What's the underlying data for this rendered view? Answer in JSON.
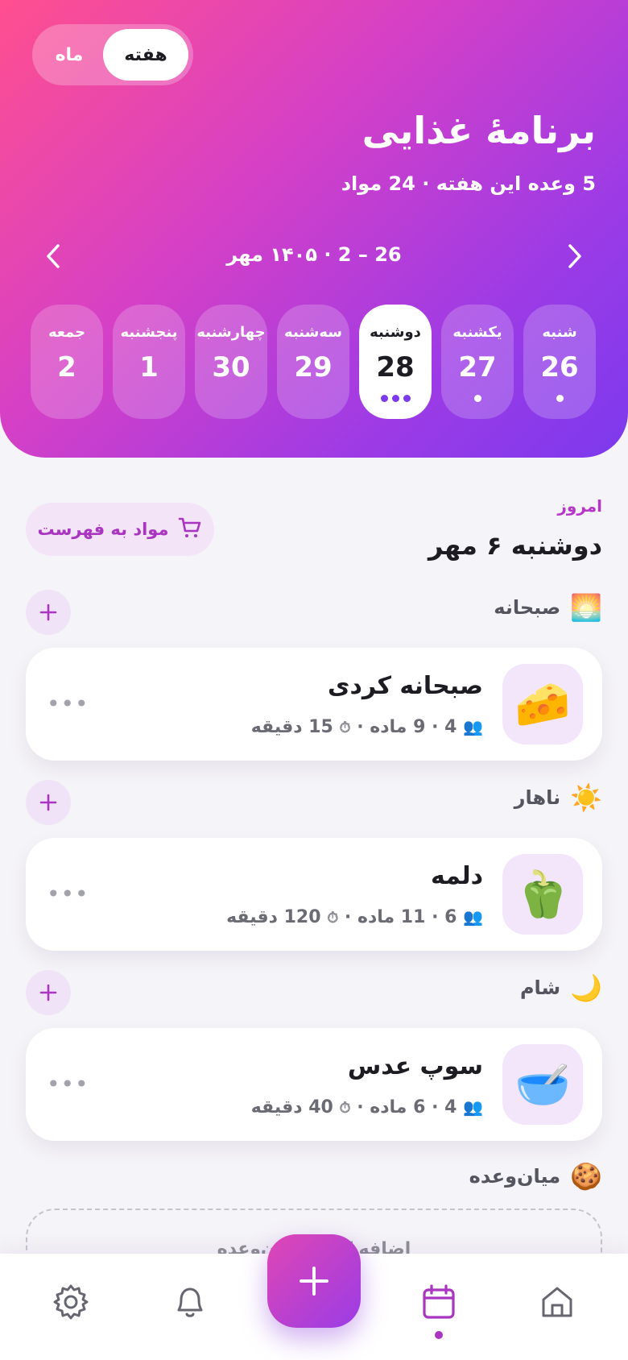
{
  "header": {
    "view_toggle": {
      "active": "هفته",
      "inactive": "ماه"
    },
    "title": "برنامۀ غذایی",
    "subtitle": "5 وعده این هفته · 24 مواد",
    "range": "26 – 2 · ۱۴۰۵ مهر",
    "days": [
      {
        "name": "شنبه",
        "num": "26",
        "dots": 1,
        "active": false
      },
      {
        "name": "یکشنبه",
        "num": "27",
        "dots": 1,
        "active": false
      },
      {
        "name": "دوشنبه",
        "num": "28",
        "dots": 3,
        "active": true
      },
      {
        "name": "سه‌شنبه",
        "num": "29",
        "dots": 0,
        "active": false
      },
      {
        "name": "چهارشنبه",
        "num": "30",
        "dots": 0,
        "active": false
      },
      {
        "name": "پنجشنبه",
        "num": "1",
        "dots": 0,
        "active": false
      },
      {
        "name": "جمعه",
        "num": "2",
        "dots": 0,
        "active": false
      }
    ]
  },
  "today": {
    "label": "امروز",
    "date": "دوشنبه ۶ مهر",
    "list_button": "مواد به فهرست"
  },
  "sections": {
    "breakfast": {
      "label": "صبحانه",
      "emoji": "🌅",
      "meal": {
        "name": "صبحانه کردی",
        "emoji": "🧀",
        "servings": "4",
        "ingredients": "9 ماده",
        "time": "15 دقیقه"
      }
    },
    "lunch": {
      "label": "ناهار",
      "emoji": "☀️",
      "meal": {
        "name": "دلمه",
        "emoji": "🫑",
        "servings": "6",
        "ingredients": "11 ماده",
        "time": "120 دقیقه"
      }
    },
    "dinner": {
      "label": "شام",
      "emoji": "🌙",
      "meal": {
        "name": "سوپ عدس",
        "emoji": "🥣",
        "servings": "4",
        "ingredients": "6 ماده",
        "time": "40 دقیقه"
      }
    },
    "snack": {
      "label": "میان‌وعده",
      "emoji": "🍪",
      "placeholder": "اضافه کردن میان‌وعده"
    }
  },
  "bottom_nav": {
    "items": [
      "settings-icon",
      "bell-icon",
      "calendar-icon",
      "home-icon"
    ],
    "active": "calendar-icon"
  },
  "colors": {
    "accent": "#a935c0",
    "gradient_start": "#ff4f8f",
    "gradient_end": "#7c3aed"
  }
}
